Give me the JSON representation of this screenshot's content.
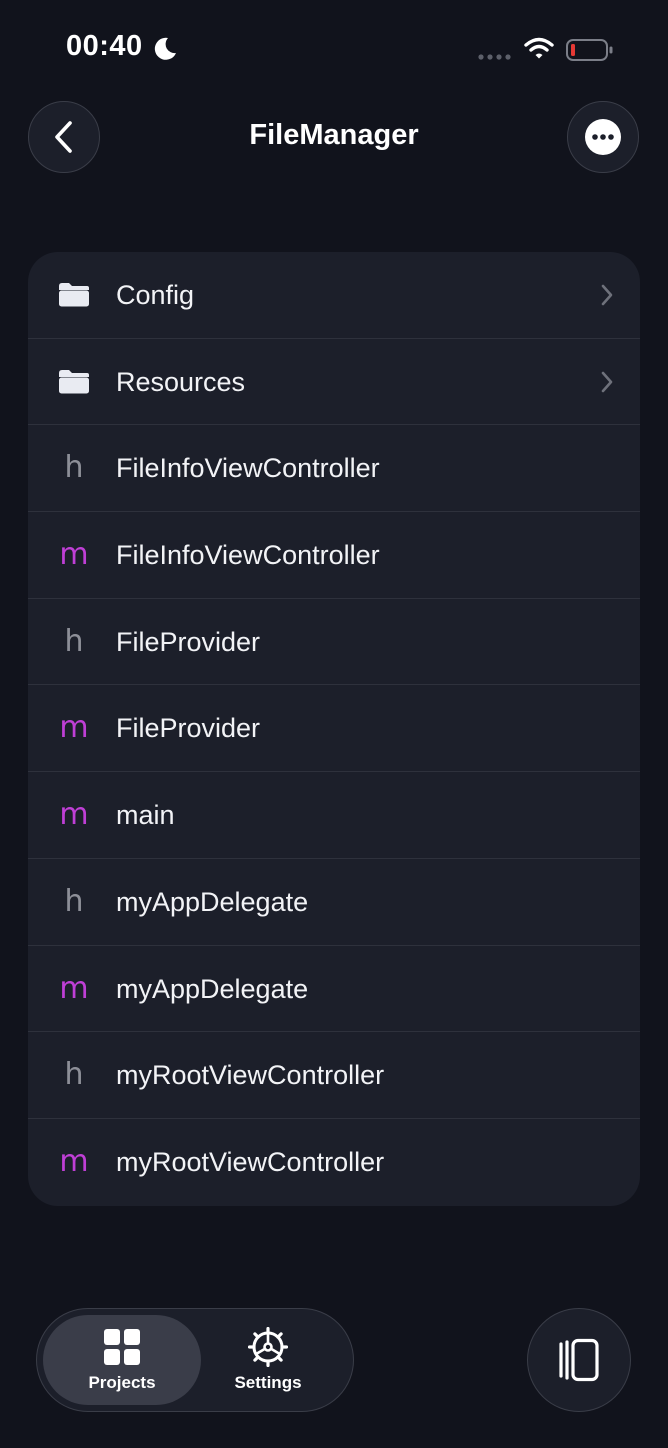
{
  "status_bar": {
    "time": "00:40",
    "focus_icon": "moon-icon",
    "wifi_icon": "wifi-icon",
    "battery_icon": "battery-low-icon"
  },
  "nav": {
    "title": "FileManager",
    "back_icon": "chevron-left-icon",
    "more_icon": "ellipsis-circle-icon"
  },
  "files": [
    {
      "kind": "folder",
      "icon": "folder-icon",
      "name": "Config"
    },
    {
      "kind": "folder",
      "icon": "folder-icon",
      "name": "Resources"
    },
    {
      "kind": "h",
      "glyph": "h",
      "name": "FileInfoViewController"
    },
    {
      "kind": "m",
      "glyph": "m",
      "name": "FileInfoViewController"
    },
    {
      "kind": "h",
      "glyph": "h",
      "name": "FileProvider"
    },
    {
      "kind": "m",
      "glyph": "m",
      "name": "FileProvider"
    },
    {
      "kind": "m",
      "glyph": "m",
      "name": "main"
    },
    {
      "kind": "h",
      "glyph": "h",
      "name": "myAppDelegate"
    },
    {
      "kind": "m",
      "glyph": "m",
      "name": "myAppDelegate"
    },
    {
      "kind": "h",
      "glyph": "h",
      "name": "myRootViewController"
    },
    {
      "kind": "m",
      "glyph": "m",
      "name": "myRootViewController"
    }
  ],
  "tab_bar": {
    "tabs": [
      {
        "label": "Projects",
        "icon": "grid-icon",
        "selected": true
      },
      {
        "label": "Settings",
        "icon": "gear-icon",
        "selected": false
      }
    ],
    "panels_icon": "panels-icon"
  },
  "colors": {
    "background": "#11131c",
    "card": "#1c1f2a",
    "header_file": "#8d8f98",
    "implementation_file": "#bf3fd6",
    "selected_tab": "#3a3d49"
  }
}
